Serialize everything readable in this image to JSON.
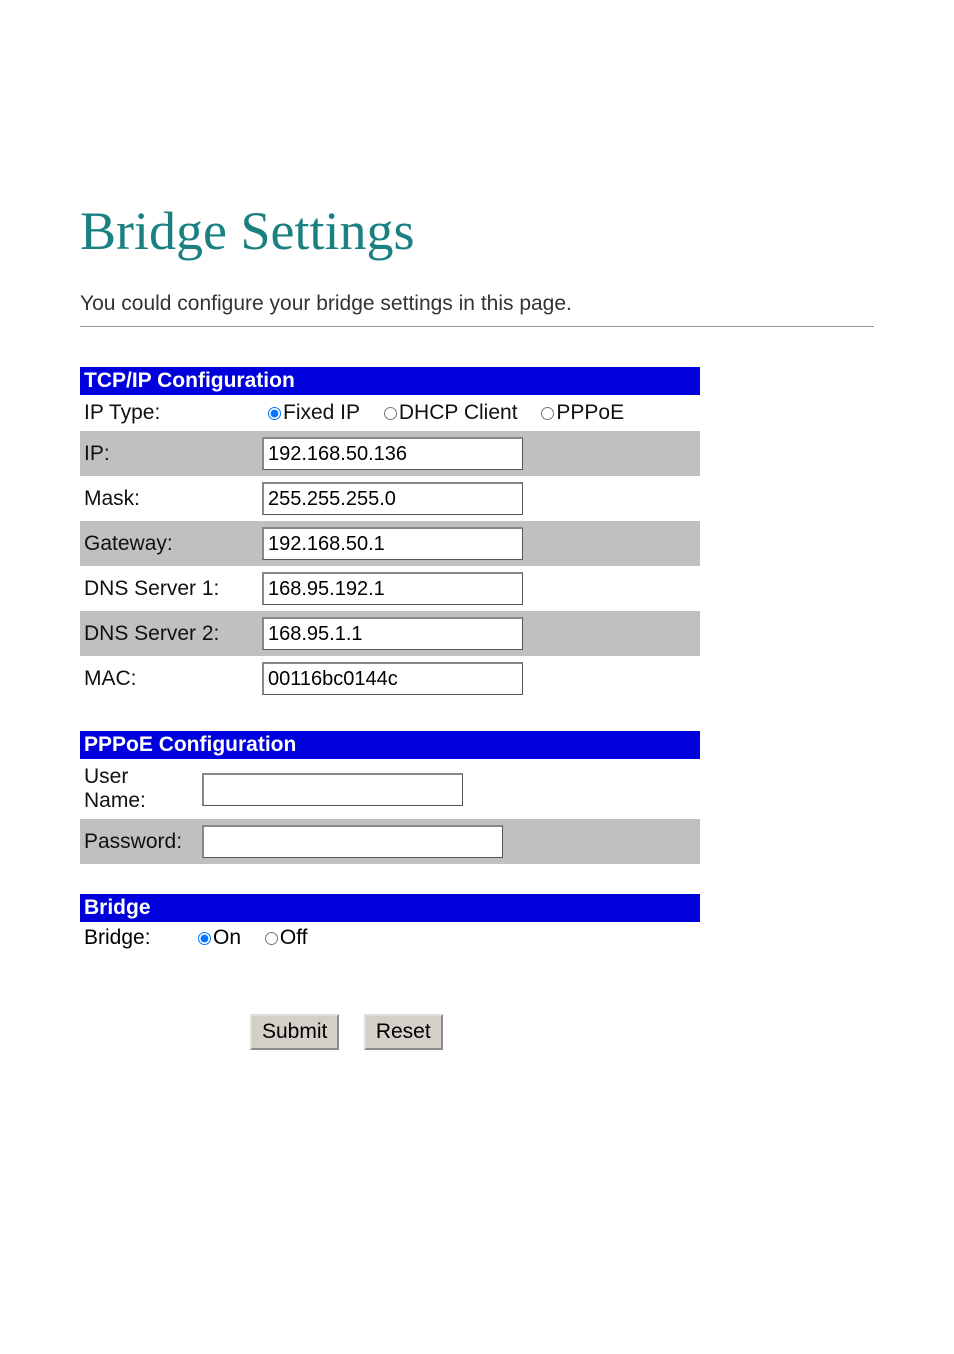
{
  "title": "Bridge Settings",
  "description": "You could configure your bridge settings in this page.",
  "tcpip": {
    "header": "TCP/IP Configuration",
    "ip_type_label": "IP Type:",
    "ip_type_options": {
      "fixed": "Fixed IP",
      "dhcp": "DHCP Client",
      "pppoe": "PPPoE"
    },
    "ip_label": "IP:",
    "ip_value": "192.168.50.136",
    "mask_label": "Mask:",
    "mask_value": "255.255.255.0",
    "gateway_label": "Gateway:",
    "gateway_value": "192.168.50.1",
    "dns1_label": "DNS Server 1:",
    "dns1_value": "168.95.192.1",
    "dns2_label": "DNS Server 2:",
    "dns2_value": "168.95.1.1",
    "mac_label": "MAC:",
    "mac_value": "00116bc0144c"
  },
  "pppoe": {
    "header": "PPPoE Configuration",
    "username_label": "User Name:",
    "username_value": "",
    "password_label": "Password:",
    "password_value": ""
  },
  "bridge": {
    "header": "Bridge",
    "label": "Bridge:",
    "options": {
      "on": "On",
      "off": "Off"
    }
  },
  "buttons": {
    "submit": "Submit",
    "reset": "Reset"
  }
}
